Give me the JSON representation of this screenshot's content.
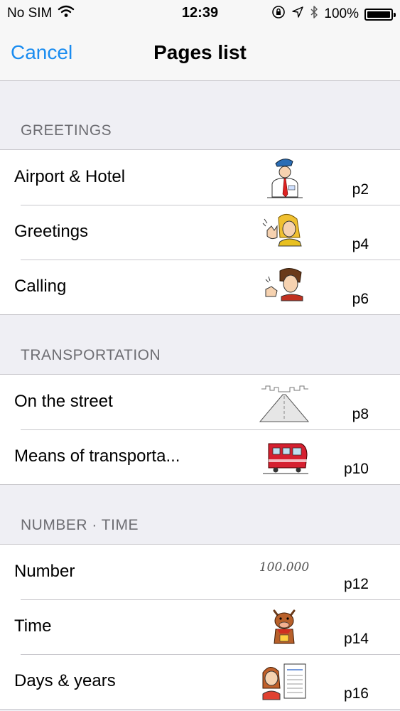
{
  "status": {
    "carrier": "No SIM",
    "time": "12:39",
    "battery": "100%",
    "battery_level": 1.0
  },
  "nav": {
    "cancel_label": "Cancel",
    "title": "Pages list"
  },
  "sections": [
    {
      "header": "GREETINGS",
      "items": [
        {
          "title": "Airport & Hotel",
          "page": "p2",
          "thumbnail": "officer-illustration"
        },
        {
          "title": "Greetings",
          "page": "p4",
          "thumbnail": "waving-woman-illustration"
        },
        {
          "title": "Calling",
          "page": "p6",
          "thumbnail": "calling-man-illustration"
        }
      ]
    },
    {
      "header": "TRANSPORTATION",
      "items": [
        {
          "title": "On the street",
          "page": "p8",
          "thumbnail": "street-illustration"
        },
        {
          "title": "Means of transporta...",
          "page": "p10",
          "thumbnail": "train-illustration"
        }
      ]
    },
    {
      "header": "NUMBER · TIME",
      "items": [
        {
          "title": "Number",
          "page": "p12",
          "thumbnail_text": "100.000"
        },
        {
          "title": "Time",
          "page": "p14",
          "thumbnail": "cow-mascot-illustration"
        },
        {
          "title": "Days & years",
          "page": "p16",
          "thumbnail": "calendar-woman-illustration"
        }
      ]
    }
  ],
  "colors": {
    "accent": "#1a8cf0",
    "background": "#efeff4",
    "section_text": "#6d6d72",
    "separator": "#c8c7cc"
  }
}
